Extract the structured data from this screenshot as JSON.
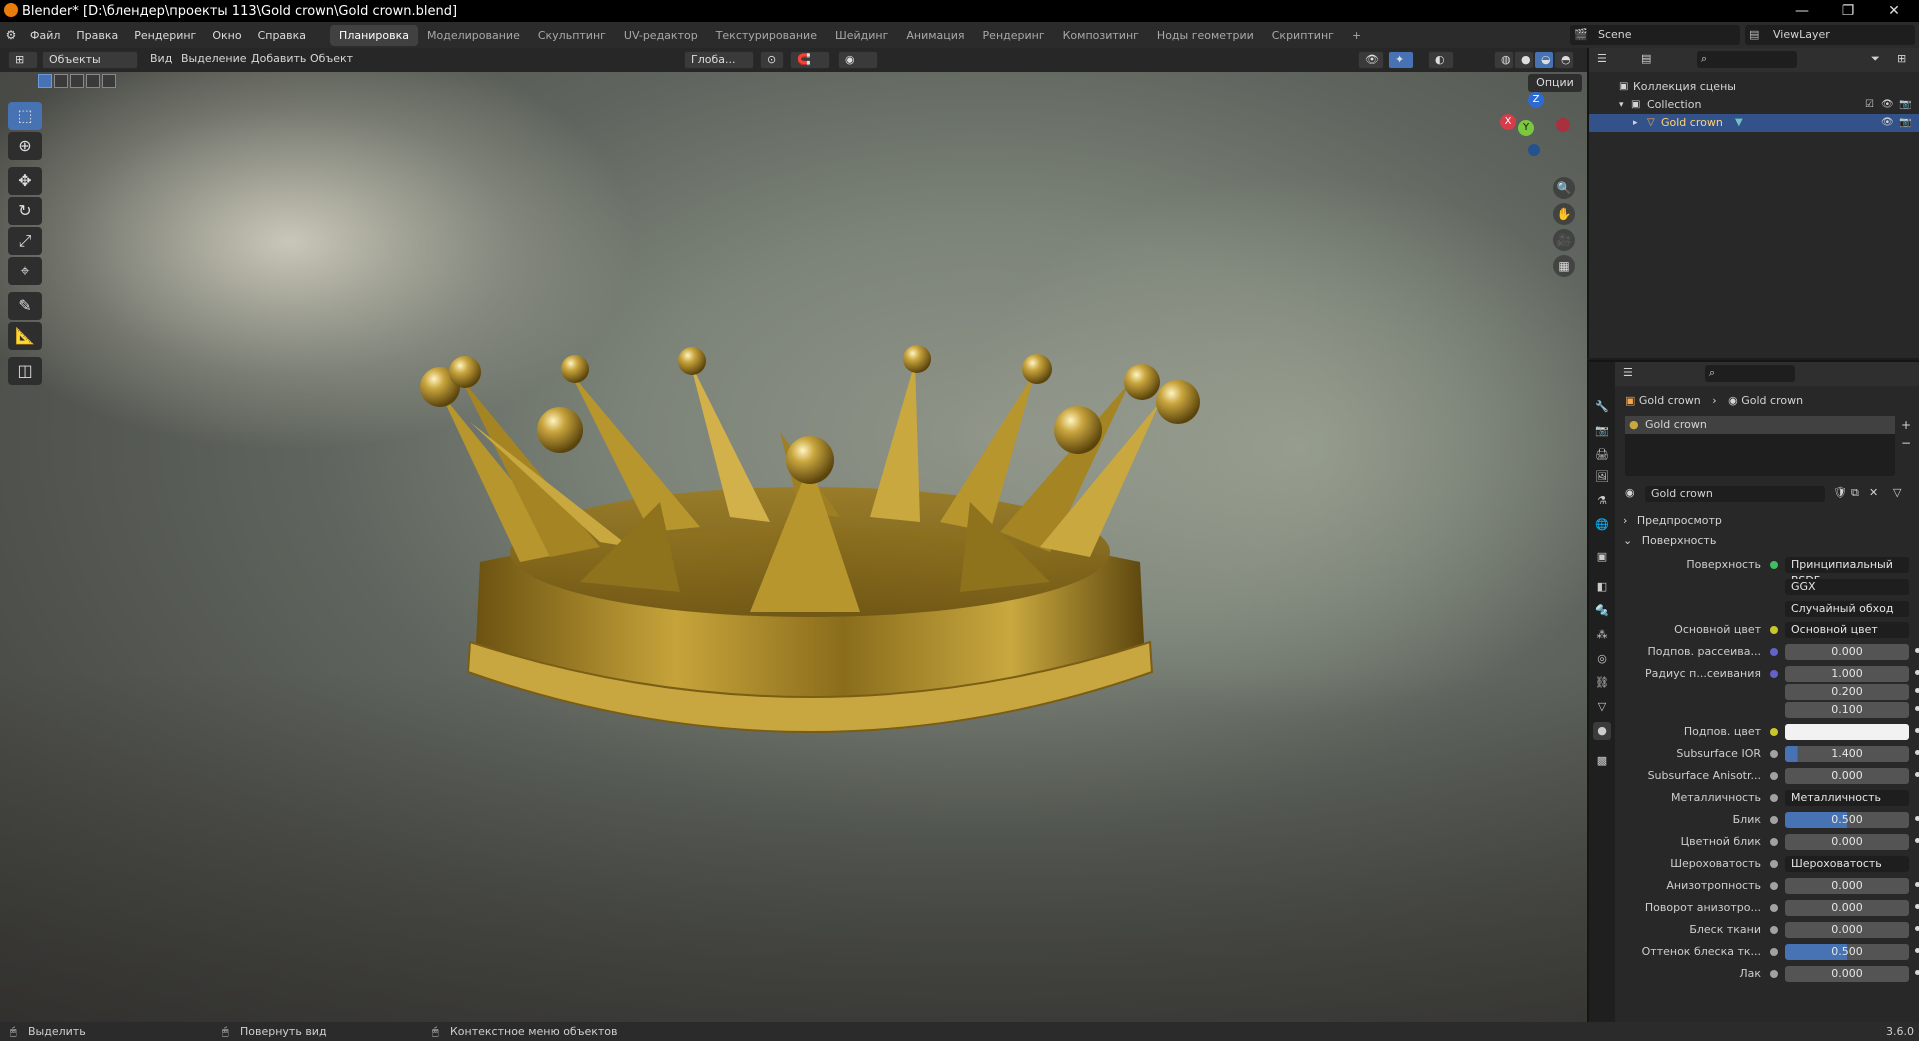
{
  "titlebar": {
    "title": "Blender* [D:\\блендер\\проекты 113\\Gold crown\\Gold crown.blend]",
    "minimize": "—",
    "maximize": "❐",
    "close": "✕"
  },
  "menu": [
    "Файл",
    "Правка",
    "Рендеринг",
    "Окно",
    "Справка"
  ],
  "workspaces": [
    "Планировка",
    "Моделирование",
    "Скульптинг",
    "UV-редактор",
    "Текстурирование",
    "Шейдинг",
    "Анимация",
    "Рендеринг",
    "Композитинг",
    "Ноды геометрии",
    "Скриптинг",
    "+"
  ],
  "scene": {
    "label": "Scene",
    "viewlayer": "ViewLayer"
  },
  "viewport_header": {
    "mode": "Объекты",
    "view": "Вид",
    "select": "Выделение",
    "add": "Добавить",
    "object": "Объект",
    "orientation": "Глоба...",
    "options": "Опции"
  },
  "gizmo": {
    "z": "Z",
    "y": "Y",
    "x": "X"
  },
  "outliner": {
    "root": "Коллекция сцены",
    "collection": "Collection",
    "object": "Gold crown"
  },
  "properties": {
    "breadcrumb_object": "Gold crown",
    "breadcrumb_material": "Gold crown",
    "slot": "Gold crown",
    "material_name": "Gold crown",
    "preview": "Предпросмотр",
    "surface_panel": "Поверхность",
    "rows": [
      {
        "label": "Поверхность",
        "value": "Принципиальный BSDF",
        "style": "dark",
        "dot": "#3fbf5f"
      },
      {
        "label": "",
        "value": "GGX",
        "style": "dark",
        "dot": ""
      },
      {
        "label": "",
        "value": "Случайный обход",
        "style": "dark",
        "dot": ""
      },
      {
        "label": "Основной цвет",
        "value": "Основной цвет",
        "style": "dark",
        "dot": "#c7c729"
      },
      {
        "label": "Подпов. рассеива...",
        "value": "0.000",
        "style": "num",
        "dot": "#6363c7"
      },
      {
        "label": "Радиус п...сеивания",
        "value": "1.000",
        "style": "num",
        "dot": "#6363c7"
      },
      {
        "label": "",
        "value": "0.200",
        "style": "num",
        "dot": ""
      },
      {
        "label": "",
        "value": "0.100",
        "style": "num",
        "dot": ""
      },
      {
        "label": "Подпов. цвет",
        "value": "",
        "style": "white",
        "dot": "#c7c729"
      },
      {
        "label": "Subsurface IOR",
        "value": "1.400",
        "style": "blue14",
        "dot": "#a1a1a1"
      },
      {
        "label": "Subsurface Anisotr...",
        "value": "0.000",
        "style": "num",
        "dot": "#a1a1a1"
      },
      {
        "label": "Металличность",
        "value": "Металличность",
        "style": "dark",
        "dot": "#a1a1a1"
      },
      {
        "label": "Блик",
        "value": "0.500",
        "style": "blue",
        "dot": "#a1a1a1"
      },
      {
        "label": "Цветной блик",
        "value": "0.000",
        "style": "num",
        "dot": "#a1a1a1"
      },
      {
        "label": "Шероховатость",
        "value": "Шероховатость",
        "style": "dark",
        "dot": "#a1a1a1"
      },
      {
        "label": "Анизотропность",
        "value": "0.000",
        "style": "num",
        "dot": "#a1a1a1"
      },
      {
        "label": "Поворот анизотро...",
        "value": "0.000",
        "style": "num",
        "dot": "#a1a1a1"
      },
      {
        "label": "Блеск ткани",
        "value": "0.000",
        "style": "num",
        "dot": "#a1a1a1"
      },
      {
        "label": "Оттенок блеска тк...",
        "value": "0.500",
        "style": "blue",
        "dot": "#a1a1a1"
      },
      {
        "label": "Лак",
        "value": "0.000",
        "style": "num",
        "dot": "#a1a1a1"
      }
    ]
  },
  "statusbar": {
    "select": "Выделить",
    "rotate": "Повернуть вид",
    "context": "Контекстное меню объектов",
    "version": "3.6.0"
  },
  "colors": {
    "accent": "#4772b3",
    "gold": "#b8962e"
  }
}
